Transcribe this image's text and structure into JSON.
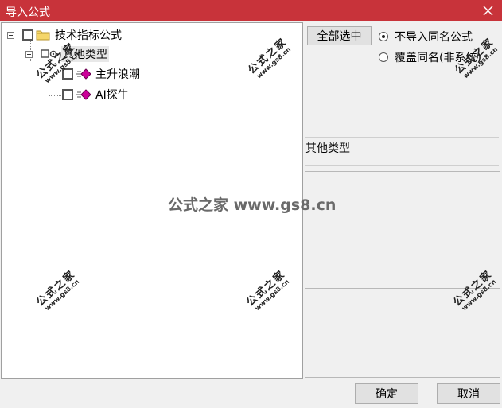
{
  "window": {
    "title": "导入公式",
    "close_icon": "close-icon"
  },
  "tree": {
    "root": {
      "label": "技术指标公式",
      "icon": "folder-icon",
      "checked": false
    },
    "category": {
      "label": "其他类型",
      "icon": "gear-icon"
    },
    "items": [
      {
        "label": "主升浪潮",
        "icon": "diamond-icon",
        "checked": false
      },
      {
        "label": "AI探牛",
        "icon": "diamond-icon",
        "checked": false
      }
    ]
  },
  "options": {
    "select_all_label": "全部选中",
    "radio_skip_label": "不导入同名公式",
    "radio_overwrite_label": "覆盖同名(非系统)",
    "selected_radio": "skip"
  },
  "info": {
    "category_text": "其他类型"
  },
  "footer": {
    "ok_label": "确定",
    "cancel_label": "取消"
  },
  "watermark": {
    "text": "公式之家",
    "url": "www.gs8.cn",
    "center_text": "公式之家 www.gs8.cn"
  },
  "colors": {
    "titlebar": "#c8333a",
    "icon_magenta": "#cc0099"
  }
}
